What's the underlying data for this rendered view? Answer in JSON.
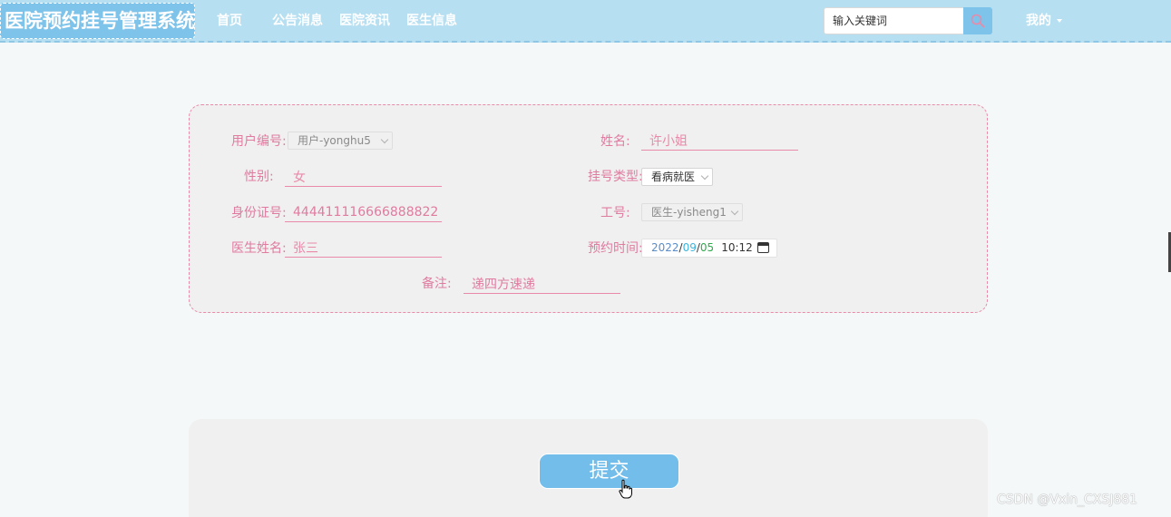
{
  "header": {
    "logo": "医院预约挂号管理系统",
    "nav": [
      {
        "label": "首页"
      },
      {
        "label": "公告消息"
      },
      {
        "label": "医院资讯"
      },
      {
        "label": "医生信息"
      }
    ],
    "search": {
      "placeholder": "输入关键词",
      "icon": "search-icon"
    },
    "mine": "我的"
  },
  "form": {
    "user_id": {
      "label": "用户编号:",
      "value": "用户-yonghu5"
    },
    "name": {
      "label": "姓名:",
      "value": "许小姐"
    },
    "gender": {
      "label": "性别:",
      "value": "女"
    },
    "reg_type": {
      "label": "挂号类型:",
      "value": "看病就医"
    },
    "id_card": {
      "label": "身份证号:",
      "value": "444411116666888822"
    },
    "work_id": {
      "label": "工号:",
      "value": "医生-yisheng1"
    },
    "doctor_name": {
      "label": "医生姓名:",
      "value": "张三"
    },
    "appt_time": {
      "label": "预约时间:",
      "year": "2022",
      "month": "09",
      "day": "05",
      "sep": "/",
      "time": "10:12"
    },
    "remark": {
      "label": "备注:",
      "value": "递四方速递"
    }
  },
  "submit": {
    "label": "提交"
  },
  "watermark": "CSDN @Vxin_CXSJ881",
  "colors": {
    "accent": "#7ec3ea",
    "label_pink": "#e07ba0",
    "topbar": "#b6dff1"
  }
}
